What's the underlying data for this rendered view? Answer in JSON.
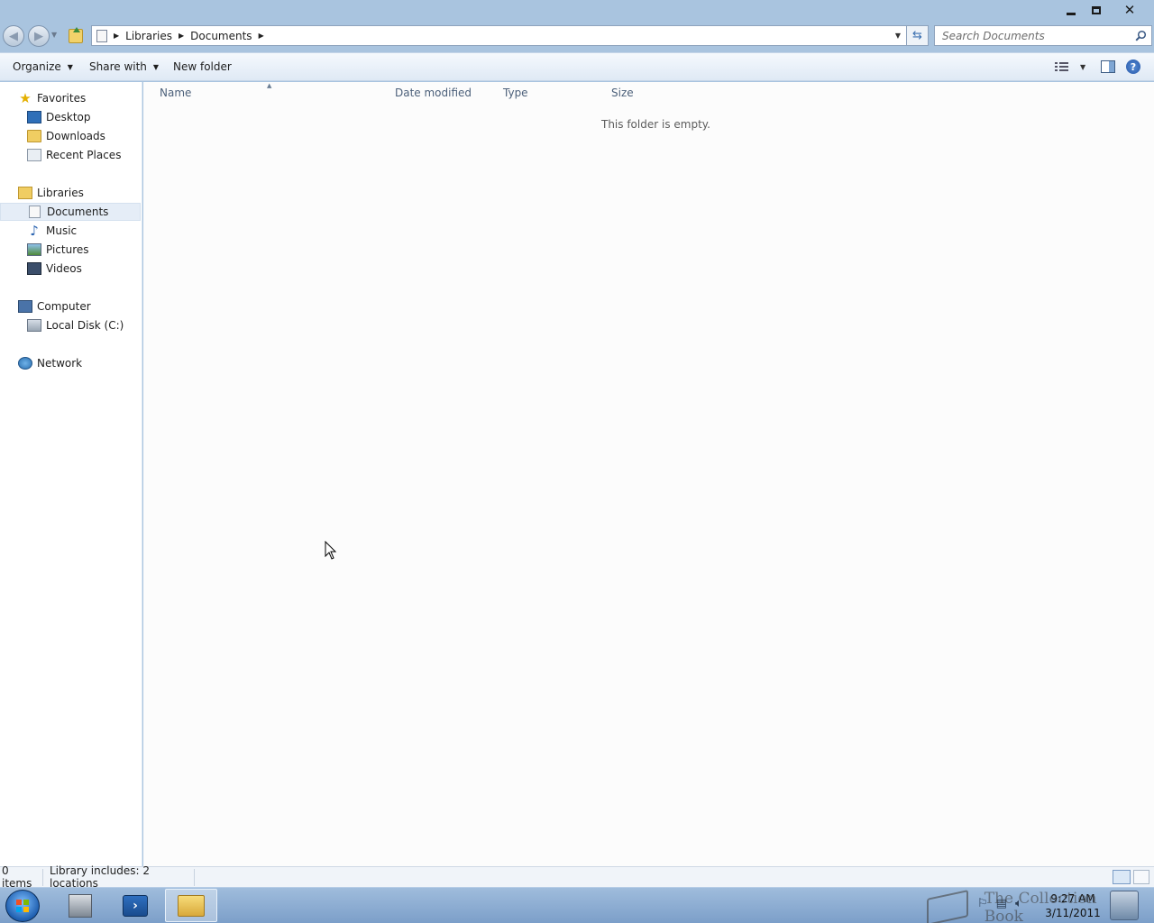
{
  "window": {
    "controls": {
      "minimize": "minimize-icon",
      "maximize": "maximize-icon",
      "close": "close-icon"
    }
  },
  "address_bar": {
    "breadcrumb": [
      "Libraries",
      "Documents"
    ],
    "search_placeholder": "Search Documents"
  },
  "command_bar": {
    "organize": "Organize",
    "share_with": "Share with",
    "new_folder": "New folder"
  },
  "nav_pane": {
    "favorites": {
      "label": "Favorites",
      "items": [
        "Desktop",
        "Downloads",
        "Recent Places"
      ]
    },
    "libraries": {
      "label": "Libraries",
      "items": [
        "Documents",
        "Music",
        "Pictures",
        "Videos"
      ],
      "selected": "Documents"
    },
    "computer": {
      "label": "Computer",
      "items": [
        "Local Disk (C:)"
      ]
    },
    "network": {
      "label": "Network"
    }
  },
  "file_list": {
    "columns": [
      "Name",
      "Date modified",
      "Type",
      "Size"
    ],
    "sort_column": "Name",
    "empty_message": "This folder is empty."
  },
  "status_bar": {
    "item_count": "0 items",
    "library_info": "Library includes:  2 locations"
  },
  "taskbar": {
    "clock_time": "9:27 AM",
    "clock_date": "3/11/2011",
    "watermark": "The Collection Book"
  },
  "colors": {
    "window_frame": "#a9c4df",
    "command_bar": "#dfe9f5",
    "content_bg": "#fcfcfc",
    "selected_item": "#e5edf7",
    "column_header_text": "#4c607a"
  }
}
